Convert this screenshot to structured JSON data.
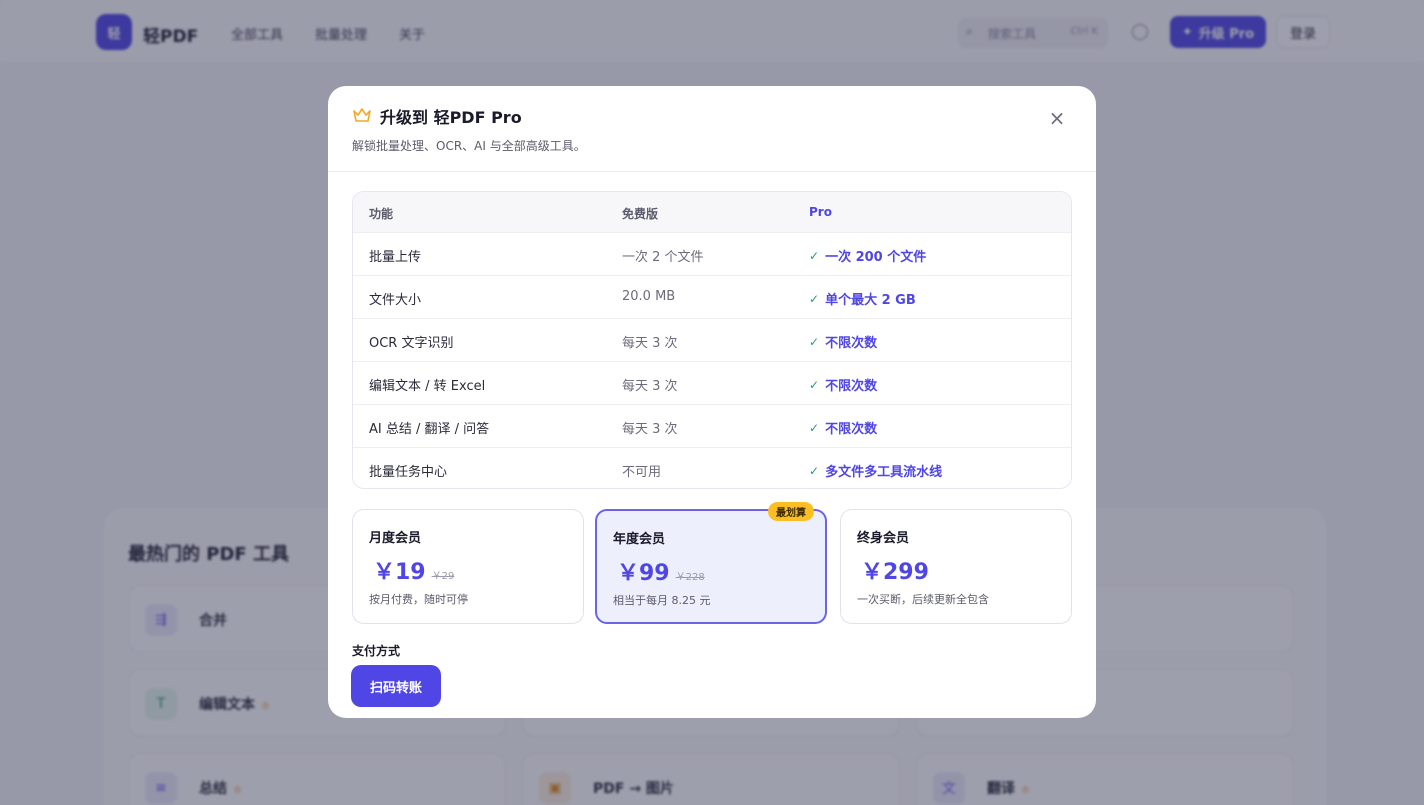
{
  "nav": {
    "logo_text": "轻",
    "brand": "轻PDF",
    "links": [
      "全部工具",
      "批量处理",
      "关于"
    ],
    "search_placeholder": "搜索工具",
    "search_shortcut": "Ctrl K",
    "upgrade_label": "升级 Pro",
    "login_label": "登录"
  },
  "background": {
    "section_title": "最热门的 PDF 工具",
    "tools": [
      {
        "name": "合并",
        "icon": "merge-icon",
        "pro": false
      },
      {
        "name": "编辑文本",
        "icon": "edit-text-icon",
        "pro": true
      },
      {
        "name": "总结",
        "icon": "summary-icon",
        "pro": true
      },
      {
        "name": "PDF → 图片",
        "icon": "image-icon",
        "pro": false
      },
      {
        "name": "翻译",
        "icon": "translate-icon",
        "pro": true
      }
    ]
  },
  "modal": {
    "title": "升级到 轻PDF Pro",
    "subtitle": "解锁批量处理、OCR、AI 与全部高级工具。",
    "table": {
      "headers": [
        "功能",
        "免费版",
        "Pro"
      ],
      "rows": [
        {
          "feature": "批量上传",
          "free": "一次 2 个文件",
          "pro": "一次 200 个文件"
        },
        {
          "feature": "文件大小",
          "free": "20.0 MB",
          "pro": "单个最大 2 GB"
        },
        {
          "feature": "OCR 文字识别",
          "free": "每天 3 次",
          "pro": "不限次数"
        },
        {
          "feature": "编辑文本 / 转 Excel",
          "free": "每天 3 次",
          "pro": "不限次数"
        },
        {
          "feature": "AI 总结 / 翻译 / 问答",
          "free": "每天 3 次",
          "pro": "不限次数"
        },
        {
          "feature": "批量任务中心",
          "free": "不可用",
          "pro": "多文件多工具流水线"
        }
      ]
    },
    "plans": [
      {
        "name": "月度会员",
        "price": "￥19",
        "old_price": "￥29",
        "note": "按月付费，随时可停",
        "selected": false
      },
      {
        "name": "年度会员",
        "price": "￥99",
        "old_price": "￥228",
        "note": "相当于每月 8.25 元",
        "selected": true
      },
      {
        "name": "终身会员",
        "price": "￥299",
        "old_price": "",
        "note": "一次买断，后续更新全包含",
        "selected": false
      }
    ],
    "badge": "最划算",
    "payment_label": "支付方式",
    "payment_button": "扫码转账"
  },
  "colors": {
    "accent": "#4f46e5",
    "badge": "#fbbf24",
    "check": "#22a06b",
    "crown": "#f5a623"
  }
}
